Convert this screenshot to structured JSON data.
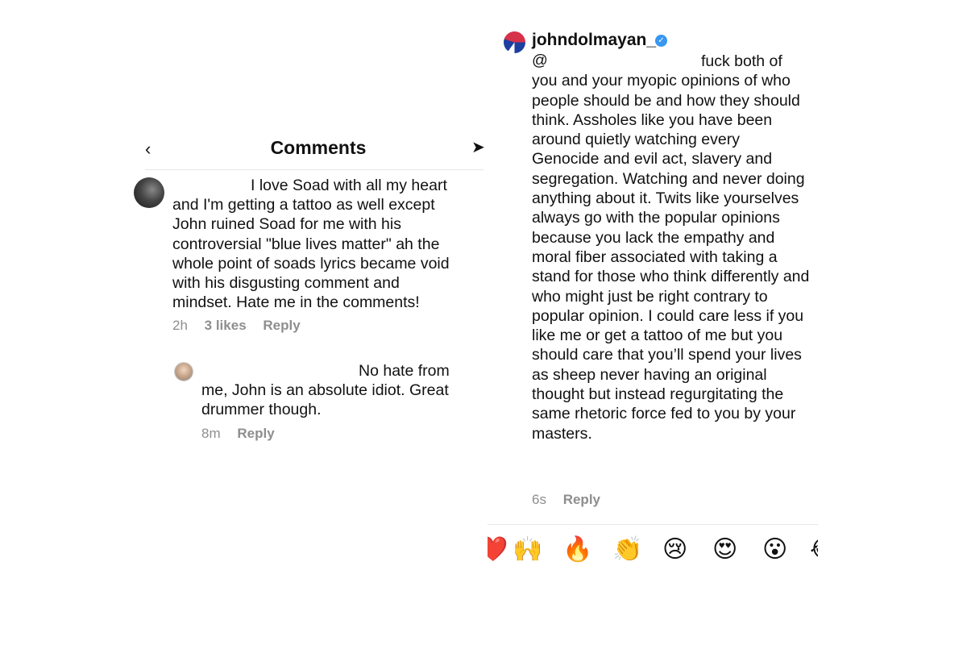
{
  "left": {
    "header": {
      "back_icon": "chevron-left-icon",
      "title": "Comments",
      "send_icon": "send-icon"
    },
    "comments": [
      {
        "text": "I love Soad with all my heart and I'm getting a tattoo as well except John ruined Soad for me with his controversial \"blue lives matter\" ah the whole point of soads lyrics became void with his disgusting comment and mindset. Hate me in the comments!",
        "time": "2h",
        "likes": "3 likes",
        "reply": "Reply"
      },
      {
        "text": "No hate from me, John is an absolute idiot. Great drummer though.",
        "time": "8m",
        "reply": "Reply"
      }
    ]
  },
  "right": {
    "username": "johndolmayan_",
    "verified_icon": "verified-badge-icon",
    "mention": "@",
    "text": "fuck both of you and your myopic opinions of who people should be and how they should think. Assholes like you have been around quietly watching every Genocide and evil act, slavery and segregation. Watching and never doing anything about it. Twits like yourselves always go with the popular opinions because you lack the empathy and moral fiber associated with taking a stand for those who think differently and who might just be right contrary to popular opinion. I could care less if you like me or get a tattoo of me but you should care that you’ll spend your lives as sheep never having an original thought but instead regurgitating the same rhetoric force fed to you by your masters.",
    "time": "6s",
    "reply": "Reply",
    "emojis": [
      "❤️",
      "🙌",
      "🔥",
      "👏",
      "😢",
      "😍",
      "😮",
      "😂"
    ]
  }
}
